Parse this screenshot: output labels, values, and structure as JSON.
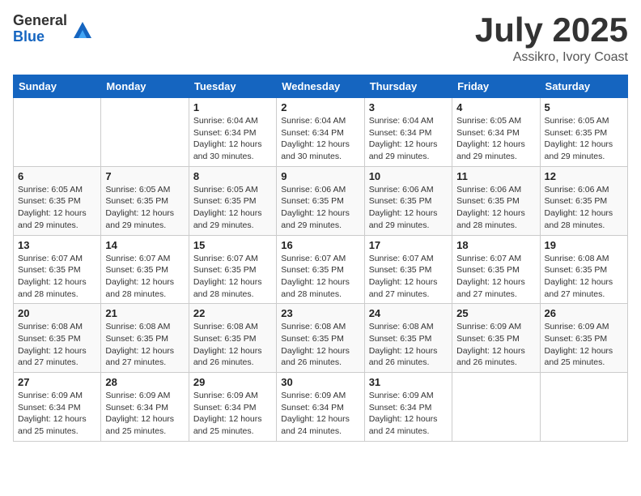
{
  "logo": {
    "general": "General",
    "blue": "Blue"
  },
  "title": {
    "month": "July 2025",
    "location": "Assikro, Ivory Coast"
  },
  "days_of_week": [
    "Sunday",
    "Monday",
    "Tuesday",
    "Wednesday",
    "Thursday",
    "Friday",
    "Saturday"
  ],
  "weeks": [
    [
      {
        "day": "",
        "info": ""
      },
      {
        "day": "",
        "info": ""
      },
      {
        "day": "1",
        "info": "Sunrise: 6:04 AM\nSunset: 6:34 PM\nDaylight: 12 hours and 30 minutes."
      },
      {
        "day": "2",
        "info": "Sunrise: 6:04 AM\nSunset: 6:34 PM\nDaylight: 12 hours and 30 minutes."
      },
      {
        "day": "3",
        "info": "Sunrise: 6:04 AM\nSunset: 6:34 PM\nDaylight: 12 hours and 29 minutes."
      },
      {
        "day": "4",
        "info": "Sunrise: 6:05 AM\nSunset: 6:34 PM\nDaylight: 12 hours and 29 minutes."
      },
      {
        "day": "5",
        "info": "Sunrise: 6:05 AM\nSunset: 6:35 PM\nDaylight: 12 hours and 29 minutes."
      }
    ],
    [
      {
        "day": "6",
        "info": "Sunrise: 6:05 AM\nSunset: 6:35 PM\nDaylight: 12 hours and 29 minutes."
      },
      {
        "day": "7",
        "info": "Sunrise: 6:05 AM\nSunset: 6:35 PM\nDaylight: 12 hours and 29 minutes."
      },
      {
        "day": "8",
        "info": "Sunrise: 6:05 AM\nSunset: 6:35 PM\nDaylight: 12 hours and 29 minutes."
      },
      {
        "day": "9",
        "info": "Sunrise: 6:06 AM\nSunset: 6:35 PM\nDaylight: 12 hours and 29 minutes."
      },
      {
        "day": "10",
        "info": "Sunrise: 6:06 AM\nSunset: 6:35 PM\nDaylight: 12 hours and 29 minutes."
      },
      {
        "day": "11",
        "info": "Sunrise: 6:06 AM\nSunset: 6:35 PM\nDaylight: 12 hours and 28 minutes."
      },
      {
        "day": "12",
        "info": "Sunrise: 6:06 AM\nSunset: 6:35 PM\nDaylight: 12 hours and 28 minutes."
      }
    ],
    [
      {
        "day": "13",
        "info": "Sunrise: 6:07 AM\nSunset: 6:35 PM\nDaylight: 12 hours and 28 minutes."
      },
      {
        "day": "14",
        "info": "Sunrise: 6:07 AM\nSunset: 6:35 PM\nDaylight: 12 hours and 28 minutes."
      },
      {
        "day": "15",
        "info": "Sunrise: 6:07 AM\nSunset: 6:35 PM\nDaylight: 12 hours and 28 minutes."
      },
      {
        "day": "16",
        "info": "Sunrise: 6:07 AM\nSunset: 6:35 PM\nDaylight: 12 hours and 28 minutes."
      },
      {
        "day": "17",
        "info": "Sunrise: 6:07 AM\nSunset: 6:35 PM\nDaylight: 12 hours and 27 minutes."
      },
      {
        "day": "18",
        "info": "Sunrise: 6:07 AM\nSunset: 6:35 PM\nDaylight: 12 hours and 27 minutes."
      },
      {
        "day": "19",
        "info": "Sunrise: 6:08 AM\nSunset: 6:35 PM\nDaylight: 12 hours and 27 minutes."
      }
    ],
    [
      {
        "day": "20",
        "info": "Sunrise: 6:08 AM\nSunset: 6:35 PM\nDaylight: 12 hours and 27 minutes."
      },
      {
        "day": "21",
        "info": "Sunrise: 6:08 AM\nSunset: 6:35 PM\nDaylight: 12 hours and 27 minutes."
      },
      {
        "day": "22",
        "info": "Sunrise: 6:08 AM\nSunset: 6:35 PM\nDaylight: 12 hours and 26 minutes."
      },
      {
        "day": "23",
        "info": "Sunrise: 6:08 AM\nSunset: 6:35 PM\nDaylight: 12 hours and 26 minutes."
      },
      {
        "day": "24",
        "info": "Sunrise: 6:08 AM\nSunset: 6:35 PM\nDaylight: 12 hours and 26 minutes."
      },
      {
        "day": "25",
        "info": "Sunrise: 6:09 AM\nSunset: 6:35 PM\nDaylight: 12 hours and 26 minutes."
      },
      {
        "day": "26",
        "info": "Sunrise: 6:09 AM\nSunset: 6:35 PM\nDaylight: 12 hours and 25 minutes."
      }
    ],
    [
      {
        "day": "27",
        "info": "Sunrise: 6:09 AM\nSunset: 6:34 PM\nDaylight: 12 hours and 25 minutes."
      },
      {
        "day": "28",
        "info": "Sunrise: 6:09 AM\nSunset: 6:34 PM\nDaylight: 12 hours and 25 minutes."
      },
      {
        "day": "29",
        "info": "Sunrise: 6:09 AM\nSunset: 6:34 PM\nDaylight: 12 hours and 25 minutes."
      },
      {
        "day": "30",
        "info": "Sunrise: 6:09 AM\nSunset: 6:34 PM\nDaylight: 12 hours and 24 minutes."
      },
      {
        "day": "31",
        "info": "Sunrise: 6:09 AM\nSunset: 6:34 PM\nDaylight: 12 hours and 24 minutes."
      },
      {
        "day": "",
        "info": ""
      },
      {
        "day": "",
        "info": ""
      }
    ]
  ]
}
